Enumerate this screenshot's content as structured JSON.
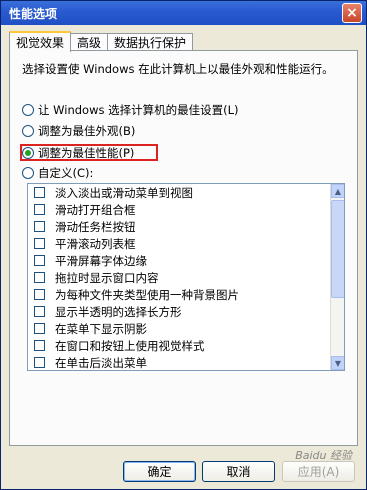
{
  "window": {
    "title": "性能选项",
    "close_label": "×"
  },
  "tabs": [
    {
      "label": "视觉效果",
      "active": true
    },
    {
      "label": "高级",
      "active": false
    },
    {
      "label": "数据执行保护",
      "active": false
    }
  ],
  "description": "选择设置使 Windows 在此计算机上以最佳外观和性能运行。",
  "radios": [
    {
      "label": "让 Windows 选择计算机的最佳设置(L)",
      "checked": false
    },
    {
      "label": "调整为最佳外观(B)",
      "checked": false
    },
    {
      "label": "调整为最佳性能(P)",
      "checked": true
    },
    {
      "label": "自定义(C):",
      "checked": false
    }
  ],
  "effects": [
    "淡入淡出或滑动菜单到视图",
    "滑动打开组合框",
    "滑动任务栏按钮",
    "平滑滚动列表框",
    "平滑屏幕字体边缘",
    "拖拉时显示窗口内容",
    "为每种文件夹类型使用一种背景图片",
    "显示半透明的选择长方形",
    "在菜单下显示阴影",
    "在窗口和按钮上使用视觉样式",
    "在单击后淡出菜单"
  ],
  "buttons": {
    "ok": "确定",
    "cancel": "取消",
    "apply": "应用(A)"
  },
  "watermark": "Baidu 经验"
}
